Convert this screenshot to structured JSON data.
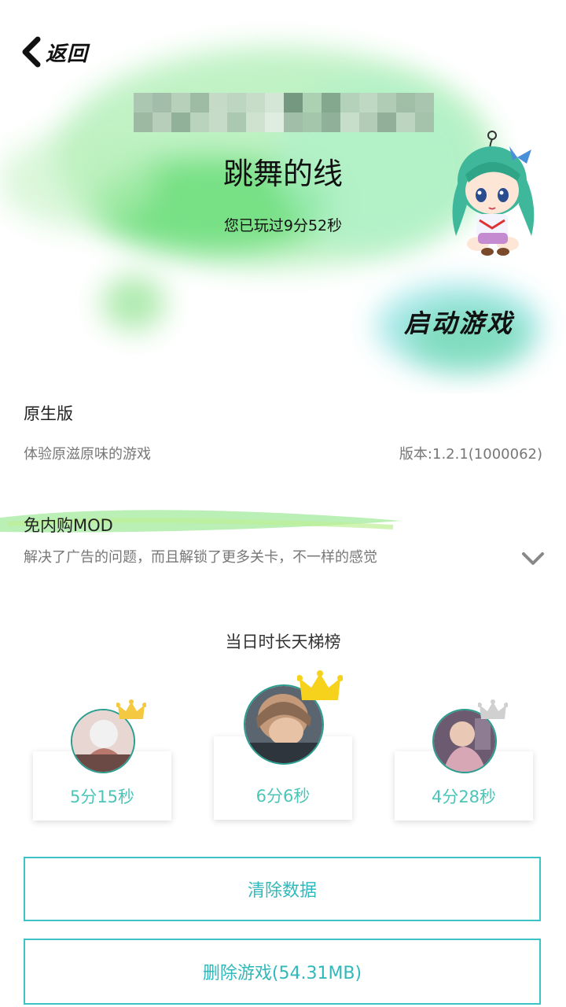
{
  "header": {
    "back_label": "返回",
    "game_title": "跳舞的线",
    "play_time": "您已玩过9分52秒",
    "launch_label": "启动游戏"
  },
  "versions": [
    {
      "name": "原生版",
      "desc": "体验原滋原味的游戏",
      "version": "版本:1.2.1(1000062)"
    },
    {
      "name": "免内购MOD",
      "desc": "解决了广告的问题，而且解锁了更多关卡，不一样的感觉"
    }
  ],
  "ranking": {
    "title": "当日时长天梯榜",
    "entries": [
      {
        "rank": 2,
        "time": "5分15秒",
        "crown_color": "#f5c842"
      },
      {
        "rank": 1,
        "time": "6分6秒",
        "crown_color": "#f7d21c"
      },
      {
        "rank": 3,
        "time": "4分28秒",
        "crown_color": "#d0d0d0"
      }
    ]
  },
  "actions": {
    "clear_data": "清除数据",
    "delete_game": "删除游戏(54.31MB)"
  },
  "colors": {
    "accent": "#3cc3c6",
    "time_text": "#4cc5b8",
    "watercolor_green": "#7be08f",
    "watercolor_teal": "#7fe0d6"
  },
  "icons": [
    "back-arrow-icon",
    "chevron-down-icon",
    "crown-icon"
  ]
}
